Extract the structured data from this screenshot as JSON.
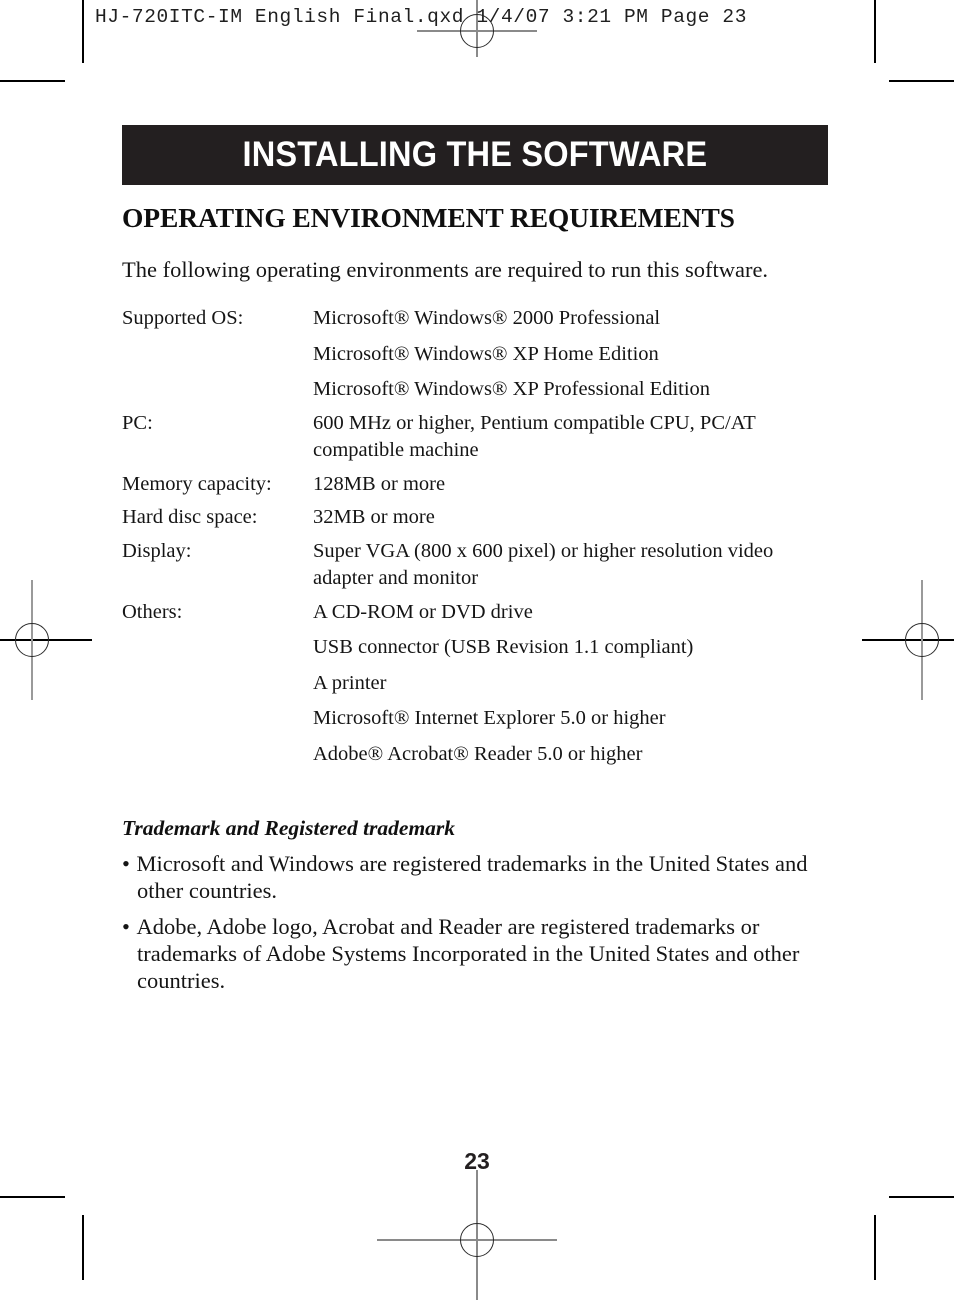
{
  "proof": {
    "file_slug": "HJ-720ITC-IM English Final.qxd   1/4/07   3:21 PM   Page 23"
  },
  "chapter": {
    "banner_title": "INSTALLING THE SOFTWARE",
    "banner_bg": "#231f20",
    "banner_fg": "#ffffff"
  },
  "section": {
    "heading": "OPERATING ENVIRONMENT REQUIREMENTS",
    "intro": "The following operating environments are required to run this software."
  },
  "requirements": [
    {
      "label": "Supported OS:",
      "values": [
        "Microsoft® Windows® 2000 Professional",
        "Microsoft® Windows® XP Home Edition",
        "Microsoft® Windows® XP Professional Edition"
      ]
    },
    {
      "label": "PC:",
      "values": [
        "600 MHz or higher, Pentium compatible CPU, PC/AT compatible machine"
      ]
    },
    {
      "label": "Memory capacity:",
      "values": [
        "128MB or more"
      ]
    },
    {
      "label": "Hard disc space:",
      "values": [
        "32MB or more"
      ]
    },
    {
      "label": "Display:",
      "values": [
        "Super VGA (800 x 600 pixel) or higher resolution video adapter and monitor"
      ]
    },
    {
      "label": "Others:",
      "values": [
        "A CD-ROM or DVD drive",
        "USB connector (USB Revision 1.1 compliant)",
        "A printer",
        "Microsoft® Internet Explorer 5.0 or higher",
        "Adobe® Acrobat® Reader 5.0 or higher"
      ]
    }
  ],
  "trademark": {
    "heading": "Trademark and Registered trademark",
    "bullet_glyph": "•",
    "items": [
      "Microsoft and Windows are registered trademarks in the United States and other countries.",
      "Adobe, Adobe logo, Acrobat and Reader are registered trademarks or trademarks of Adobe Systems Incorporated in the United States and other countries."
    ]
  },
  "folio": {
    "page_number": "23"
  }
}
